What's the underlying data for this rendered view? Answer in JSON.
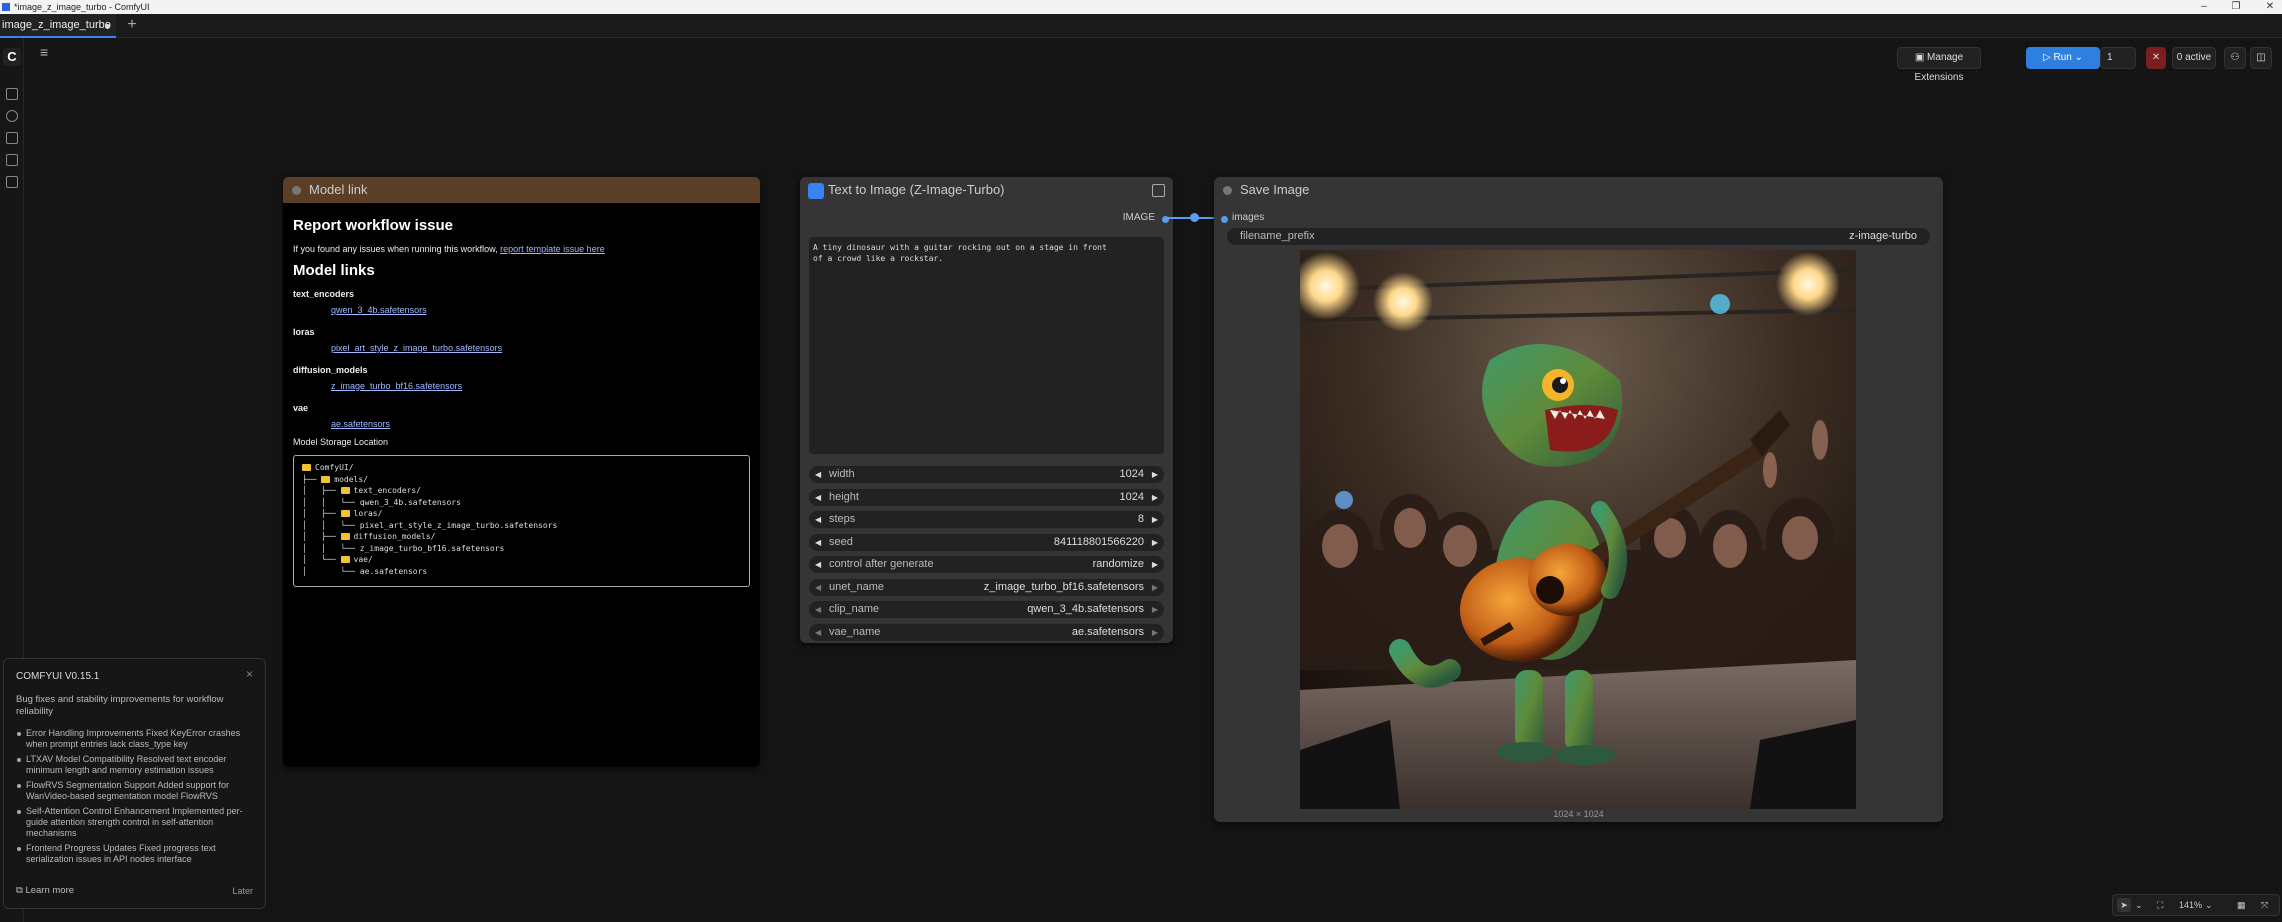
{
  "window": {
    "title": "*image_z_image_turbo - ComfyUI",
    "controls": [
      "–",
      "❐",
      "✕"
    ]
  },
  "tabs": [
    {
      "label": "image_z_image_turbo",
      "modified": true
    }
  ],
  "newtab_label": "+",
  "sidebar": {
    "logo": "C",
    "icons": [
      "images-icon",
      "models-icon",
      "nodes-icon",
      "workflows-icon",
      "templates-icon"
    ]
  },
  "toolbar": {
    "manage_extensions": "Manage Extensions",
    "run": "Run",
    "queue_count": "1",
    "active": "0 active"
  },
  "note": {
    "title": "Model link",
    "h_report": "Report workflow issue",
    "report_text": "If you found any issues when running this workflow,",
    "report_link": "report template issue here",
    "h_models": "Model links",
    "categories": [
      {
        "name": "text_encoders",
        "file": "qwen_3_4b.safetensors"
      },
      {
        "name": "loras",
        "file": "pixel_art_style_z_image_turbo.safetensors"
      },
      {
        "name": "diffusion_models",
        "file": "z_image_turbo_bf16.safetensors"
      },
      {
        "name": "vae",
        "file": "ae.safetensors"
      }
    ],
    "storage_label": "Model Storage Location",
    "tree": {
      "root": "ComfyUI/",
      "models": "models/",
      "te": "text_encoders/",
      "te_file": "qwen_3_4b.safetensors",
      "lo": "loras/",
      "lo_file": "pixel_art_style_z_image_turbo.safetensors",
      "dm": "diffusion_models/",
      "dm_file": "z_image_turbo_bf16.safetensors",
      "vae": "vae/",
      "vae_file": "ae.safetensors"
    }
  },
  "t2i": {
    "title": "Text to Image (Z-Image-Turbo)",
    "output": "IMAGE",
    "prompt": "A tiny dinosaur with a guitar rocking out on a stage in front\nof a crowd like a rockstar.",
    "widgets": [
      {
        "label": "width",
        "value": "1024"
      },
      {
        "label": "height",
        "value": "1024"
      },
      {
        "label": "steps",
        "value": "8"
      },
      {
        "label": "seed",
        "value": "841118801566220"
      },
      {
        "label": "control after generate",
        "value": "randomize"
      },
      {
        "label": "unet_name",
        "value": "z_image_turbo_bf16.safetensors"
      },
      {
        "label": "clip_name",
        "value": "qwen_3_4b.safetensors"
      },
      {
        "label": "vae_name",
        "value": "ae.safetensors"
      }
    ]
  },
  "save": {
    "title": "Save Image",
    "input": "images",
    "filename_prefix_label": "filename_prefix",
    "filename_prefix_value": "z-image-turbo",
    "image_size": "1024 × 1024"
  },
  "popup": {
    "title": "COMFYUI V0.15.1",
    "close": "×",
    "desc": "Bug fixes and stability improvements for workflow reliability",
    "items": [
      "Error Handling Improvements  Fixed KeyError crashes when prompt entries lack class_type key",
      "LTXAV Model Compatibility  Resolved text encoder minimum length and memory estimation issues",
      "FlowRVS Segmentation Support  Added support for WanVideo-based segmentation model FlowRVS",
      "Self-Attention Control Enhancement  Implemented per-guide attention strength control in self-attention mechanisms",
      "Frontend Progress Updates  Fixed progress text serialization issues in API nodes interface"
    ],
    "learn_more": "Learn more",
    "later": "Later"
  },
  "bottom": {
    "zoom": "141%"
  },
  "colors": {
    "accent": "#3b82f6",
    "note_header": "#5a3e26",
    "link": "#5b9cf3",
    "stop": "#c0392b"
  }
}
